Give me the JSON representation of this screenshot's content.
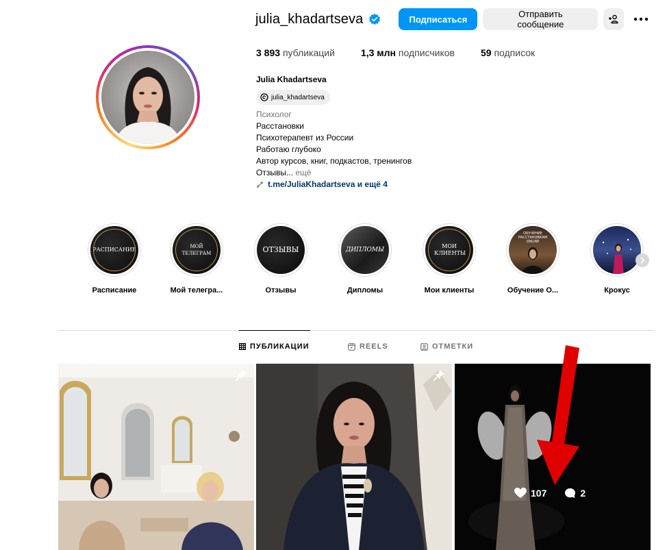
{
  "profile": {
    "username": "julia_khadartseva",
    "verified": true,
    "follow_label": "Подписаться",
    "message_label": "Отправить сообщение",
    "suggest_icon": "person-add-icon",
    "more_icon": "more-horizontal-icon"
  },
  "stats": {
    "posts_count": "3 893",
    "posts_label": "публикаций",
    "followers_count": "1,3 млн",
    "followers_label": "подписчиков",
    "following_count": "59",
    "following_label": "подписок"
  },
  "bio": {
    "full_name": "Julia Khadartseva",
    "threads_handle": "julia_khadartseva",
    "category": "Психолог",
    "lines": [
      "Расстановки",
      "Психотерапевт из России",
      "Работаю глубоко",
      "Автор курсов, книг, подкастов, тренингов"
    ],
    "last_line": "Отзывы...",
    "more_label": "ещё",
    "link_text": "t.me/JuliaKhadartseva и ещё 4"
  },
  "highlights": [
    {
      "label": "Расписание",
      "cover_text": "РАСПИСАНИЕ"
    },
    {
      "label": "Мой телегра...",
      "cover_text": "МОЙ ТЕЛЕГРАМ"
    },
    {
      "label": "Отзывы",
      "cover_text": "ОТЗЫВЫ"
    },
    {
      "label": "Дипломы",
      "cover_text": "ДИПЛОМЫ"
    },
    {
      "label": "Мои клиенты",
      "cover_text": "МОИ КЛИЕНТЫ"
    },
    {
      "label": "Обучение О...",
      "cover_text": "ОБУЧЕНИЕ РАССТАНОВКАМ ONLINE"
    },
    {
      "label": "Крокус",
      "cover_text": ""
    }
  ],
  "tabs": [
    {
      "label": "ПУБЛИКАЦИИ",
      "icon": "grid-icon",
      "active": true
    },
    {
      "label": "REELS",
      "icon": "reels-icon",
      "active": false
    },
    {
      "label": "ОТМЕТКИ",
      "icon": "tagged-icon",
      "active": false
    }
  ],
  "posts": [
    {
      "pinned": true
    },
    {
      "pinned": true
    },
    {
      "pinned": false,
      "likes": "107",
      "comments": "2"
    }
  ],
  "colors": {
    "accent": "#0095f6",
    "annotation_arrow": "#e00000"
  }
}
